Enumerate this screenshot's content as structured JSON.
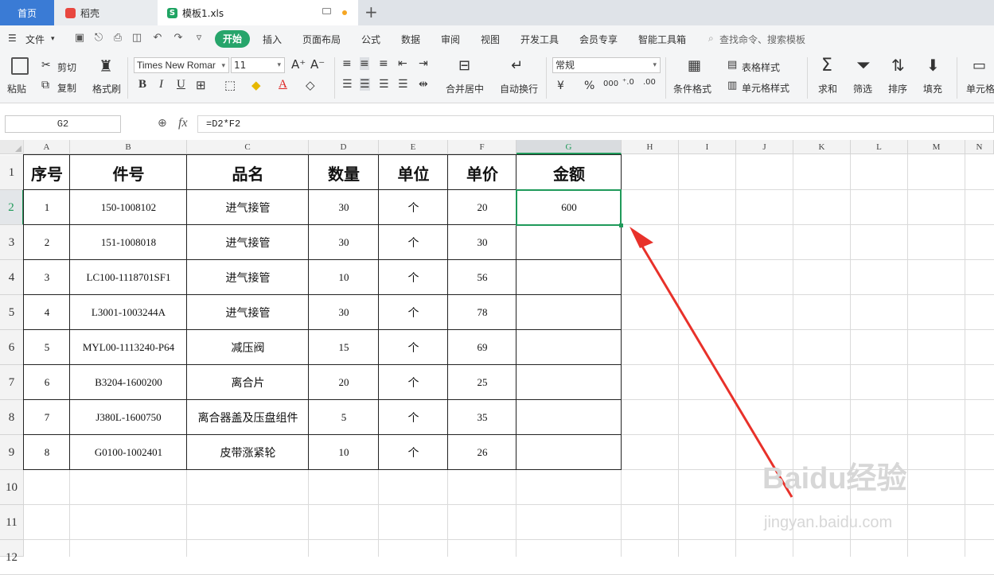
{
  "tabs": {
    "home": "首页",
    "daoke": "稻壳",
    "file": "模板1.xls",
    "file_icon": "S"
  },
  "menu": {
    "file": "文件",
    "items": [
      "开始",
      "插入",
      "页面布局",
      "公式",
      "数据",
      "审阅",
      "视图",
      "开发工具",
      "会员专享",
      "智能工具箱"
    ],
    "search_placeholder": "查找命令、搜索模板"
  },
  "ribbon": {
    "paste": "粘贴",
    "cut": "剪切",
    "copy": "复制",
    "format_painter": "格式刷",
    "font_name": "Times New Romar",
    "font_size": "11",
    "merge_center": "合并居中",
    "auto_wrap": "自动换行",
    "number_format": "常规",
    "currency": "¥",
    "percent": "%",
    "thousands": "000",
    "cond_format": "条件格式",
    "table_style": "表格样式",
    "cell_style": "单元格样式",
    "sum": "求和",
    "filter": "筛选",
    "sort": "排序",
    "fill": "填充",
    "cell": "单元格"
  },
  "formula_bar": {
    "name_box": "G2",
    "fx": "fx",
    "formula": "=D2*F2"
  },
  "columns": [
    "A",
    "B",
    "C",
    "D",
    "E",
    "F",
    "G",
    "H",
    "I",
    "J",
    "K",
    "L",
    "M",
    "N"
  ],
  "rows": [
    "1",
    "2",
    "3",
    "4",
    "5",
    "6",
    "7",
    "8",
    "9",
    "10",
    "11",
    "12"
  ],
  "table": {
    "headers": [
      "序号",
      "件号",
      "品名",
      "数量",
      "单位",
      "单价",
      "金额"
    ],
    "rows": [
      [
        "1",
        "150-1008102",
        "进气接管",
        "30",
        "个",
        "20",
        "600"
      ],
      [
        "2",
        "151-1008018",
        "进气接管",
        "30",
        "个",
        "30",
        ""
      ],
      [
        "3",
        "LC100-1118701SF1",
        "进气接管",
        "10",
        "个",
        "56",
        ""
      ],
      [
        "4",
        "L3001-1003244A",
        "进气接管",
        "30",
        "个",
        "78",
        ""
      ],
      [
        "5",
        "MYL00-1113240-P64",
        "减压阀",
        "15",
        "个",
        "69",
        ""
      ],
      [
        "6",
        "B3204-1600200",
        "离合片",
        "20",
        "个",
        "25",
        ""
      ],
      [
        "7",
        "J380L-1600750",
        "离合器盖及压盘组件",
        "5",
        "个",
        "35",
        ""
      ],
      [
        "8",
        "G0100-1002401",
        "皮带涨紧轮",
        "10",
        "个",
        "26",
        ""
      ]
    ]
  },
  "watermark": {
    "brand": "Baidu经验",
    "url": "jingyan.baidu.com"
  },
  "colors": {
    "accent": "#1f9a5a",
    "arrow": "#e8312a",
    "home_tab": "#3a7bd5"
  }
}
